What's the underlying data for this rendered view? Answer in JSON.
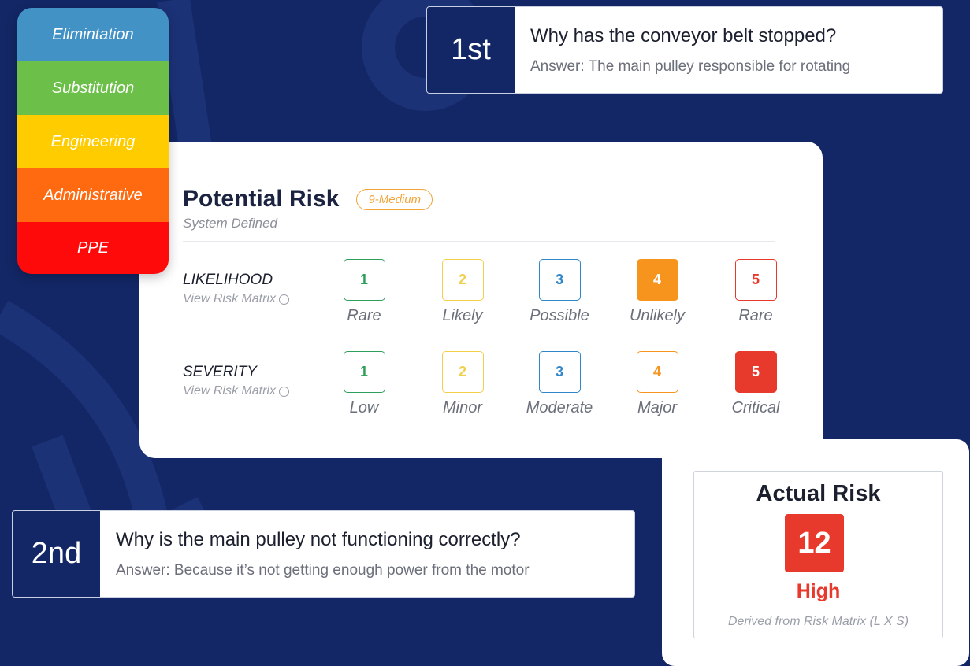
{
  "hierarchy": {
    "levels": [
      {
        "label": "Elimintation",
        "color": "#4292c6"
      },
      {
        "label": "Substitution",
        "color": "#6cc04a"
      },
      {
        "label": "Engineering",
        "color": "#ffcc00"
      },
      {
        "label": "Administrative",
        "color": "#ff6a10"
      },
      {
        "label": "PPE",
        "color": "#ff0a0a"
      }
    ]
  },
  "why1": {
    "number": "1st",
    "question": "Why has the conveyor belt stopped?",
    "answer": "Answer: The main pulley responsible for rotating"
  },
  "why2": {
    "number": "2nd",
    "question": "Why is the main pulley not functioning correctly?",
    "answer": "Answer: Because it’s not getting enough power from the motor"
  },
  "potential_risk": {
    "title": "Potential Risk",
    "badge": "9-Medium",
    "subtitle": "System Defined",
    "likelihood": {
      "label": "LIKELIHOOD",
      "matrix_link": "View Risk Matrix",
      "info_glyph": "i",
      "options": [
        {
          "value": "1",
          "label": "Rare",
          "color": "#2e9e5b",
          "selected": false
        },
        {
          "value": "2",
          "label": "Likely",
          "color": "#f2cf4a",
          "selected": false
        },
        {
          "value": "3",
          "label": "Possible",
          "color": "#2f86c8",
          "selected": false
        },
        {
          "value": "4",
          "label": "Unlikely",
          "color": "#f7941d",
          "selected": true
        },
        {
          "value": "5",
          "label": "Rare",
          "color": "#e8392d",
          "selected": false
        }
      ]
    },
    "severity": {
      "label": "SEVERITY",
      "matrix_link": "View Risk Matrix",
      "info_glyph": "i",
      "options": [
        {
          "value": "1",
          "label": "Low",
          "color": "#2e9e5b",
          "selected": false
        },
        {
          "value": "2",
          "label": "Minor",
          "color": "#f2cf4a",
          "selected": false
        },
        {
          "value": "3",
          "label": "Moderate",
          "color": "#2f86c8",
          "selected": false
        },
        {
          "value": "4",
          "label": "Major",
          "color": "#f7941d",
          "selected": false
        },
        {
          "value": "5",
          "label": "Critical",
          "color": "#e8392d",
          "selected": true
        }
      ]
    }
  },
  "actual_risk": {
    "title": "Actual Risk",
    "score": "12",
    "level": "High",
    "description": "Derived from Risk Matrix (L X S)"
  },
  "colors": {
    "background": "#132766",
    "accent_red": "#e8392d"
  }
}
